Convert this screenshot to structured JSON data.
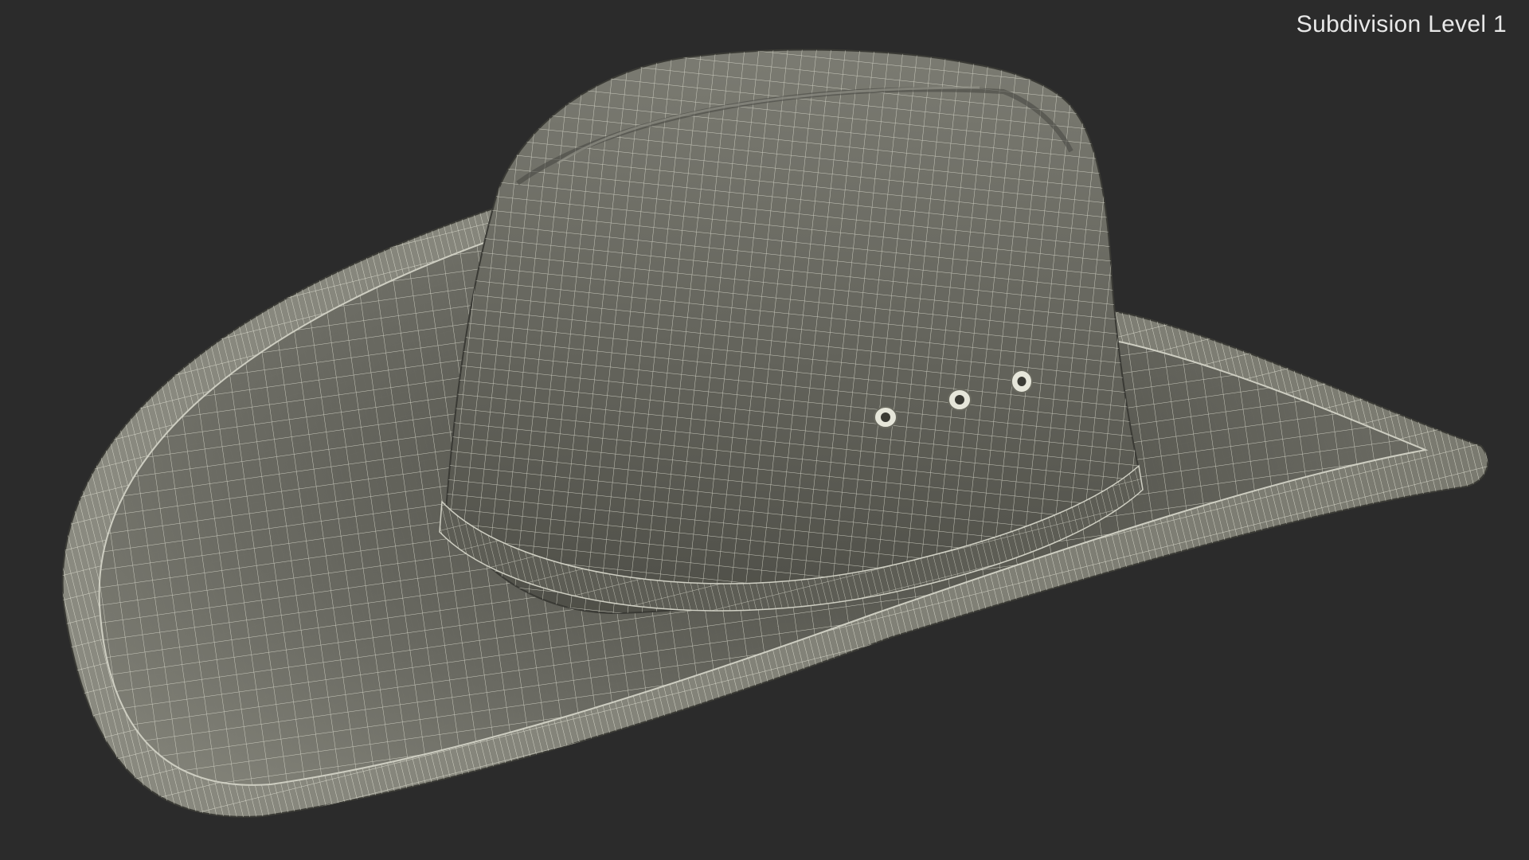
{
  "viewport": {
    "label": "Subdivision Level 1",
    "background": "#2b2b2b",
    "model": {
      "subject": "cowboy hat",
      "display": "wireframe",
      "surface_color": "#6e6e66",
      "wire_color": "#d8d8cc",
      "eyelets": 3
    }
  }
}
